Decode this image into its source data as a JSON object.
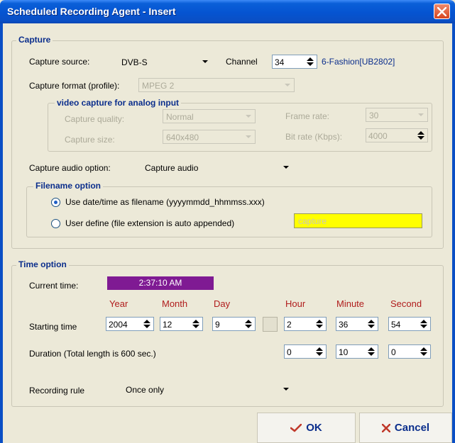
{
  "window": {
    "title": "Scheduled Recording Agent - Insert"
  },
  "capture": {
    "group_title": "Capture",
    "source_label": "Capture source:",
    "source_value": "DVB-S",
    "channel_label": "Channel",
    "channel_value": "34",
    "channel_name": "6-Fashion[UB2802]",
    "format_label": "Capture format (profile):",
    "format_value": "MPEG 2",
    "analog": {
      "group_title": "video capture for analog input",
      "quality_label": "Capture quality:",
      "quality_value": "Normal",
      "size_label": "Capture size:",
      "size_value": "640x480",
      "framerate_label": "Frame rate:",
      "framerate_value": "30",
      "bitrate_label": "Bit rate (Kbps):",
      "bitrate_value": "4000"
    },
    "audio_label": "Capture audio option:",
    "audio_value": "Capture audio",
    "filename": {
      "group_title": "Filename option",
      "option1_label": "Use date/time as filename (yyyymmdd_hhmmss.xxx)",
      "option2_label": "User define (file extension is auto appended)",
      "user_field_value": "capture",
      "selected": 1
    }
  },
  "time": {
    "group_title": "Time option",
    "current_label": "Current time:",
    "current_value": "2:37:10 AM",
    "col_year": "Year",
    "col_month": "Month",
    "col_day": "Day",
    "col_hour": "Hour",
    "col_minute": "Minute",
    "col_second": "Second",
    "start_label": "Starting time",
    "start_year": "2004",
    "start_month": "12",
    "start_day": "9",
    "start_hour": "2",
    "start_minute": "36",
    "start_second": "54",
    "duration_label": "Duration (Total length is 600 sec.)",
    "dur_hour": "0",
    "dur_minute": "10",
    "dur_second": "0",
    "rule_label": "Recording rule",
    "rule_value": "Once only"
  },
  "buttons": {
    "ok": "OK",
    "cancel": "Cancel"
  },
  "colors": {
    "title_bar": "#0554d1",
    "group_title": "#0b2e8c",
    "column_header": "#b01c1c",
    "current_time_bg": "#7f1a93",
    "user_field_bg": "#ffff00"
  }
}
